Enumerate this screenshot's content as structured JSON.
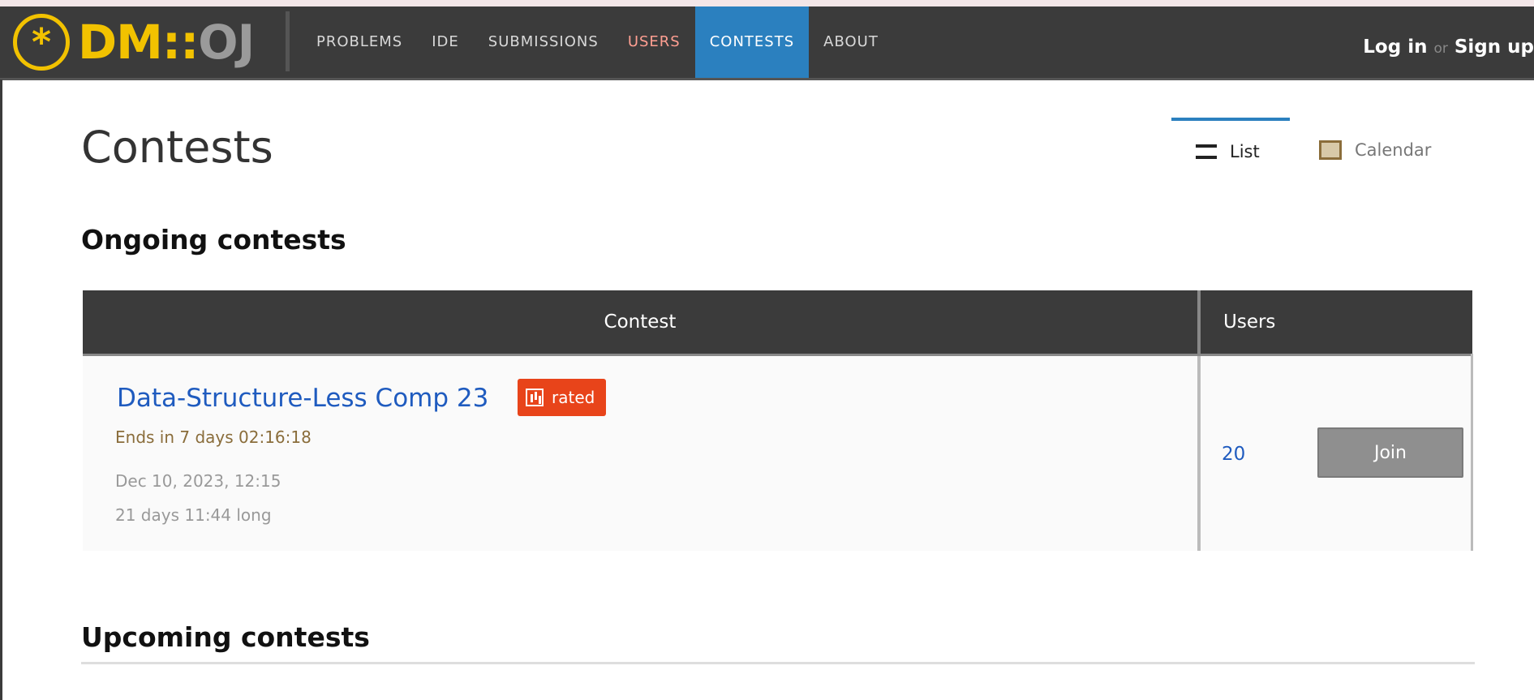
{
  "brand": {
    "logo_icon": "*",
    "logo_dm": "DM",
    "logo_sep": "::",
    "logo_oj": "OJ"
  },
  "nav": {
    "items": [
      {
        "label": "Problems"
      },
      {
        "label": "Ide"
      },
      {
        "label": "Submissions"
      },
      {
        "label": "Users"
      },
      {
        "label": "Contests"
      },
      {
        "label": "About"
      }
    ],
    "active": "Contests"
  },
  "auth": {
    "login": "Log in",
    "or": "or",
    "signup": "Sign up"
  },
  "page": {
    "title": "Contests"
  },
  "view_tabs": {
    "list": "List",
    "calendar": "Calendar"
  },
  "ongoing": {
    "heading": "Ongoing contests",
    "table": {
      "headers": {
        "contest": "Contest",
        "users": "Users"
      },
      "rows": [
        {
          "name": "Data-Structure-Less Comp 23",
          "badge": "rated",
          "ends_in": "Ends in 7 days 02:16:18",
          "start": "Dec 10, 2023, 12:15",
          "length": "21 days 11:44 long",
          "users": "20",
          "join_label": "Join"
        }
      ]
    }
  },
  "upcoming": {
    "heading": "Upcoming contests"
  },
  "colors": {
    "navbar": "#3b3b3b",
    "accent": "#2b80bf",
    "brand_yellow": "#f2c200",
    "rated_badge": "#e8441a",
    "link": "#1f5bbf"
  }
}
